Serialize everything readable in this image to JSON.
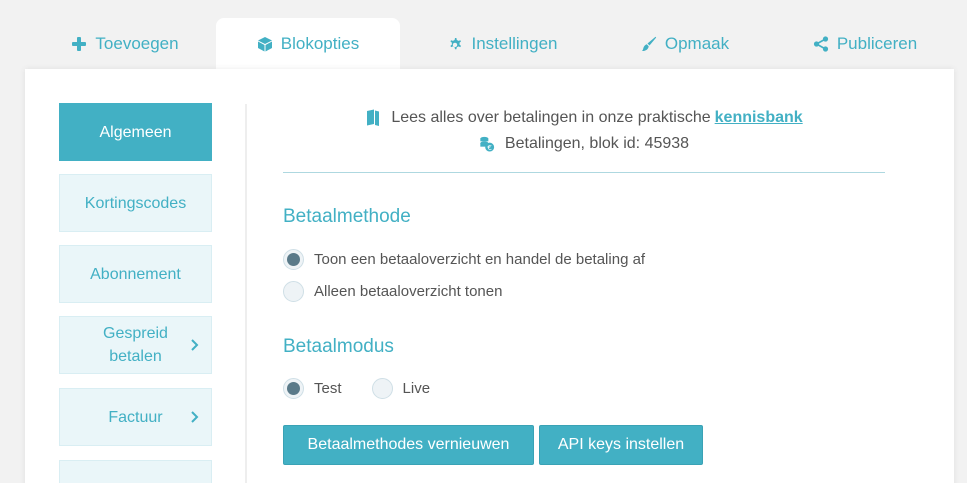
{
  "tabs": [
    {
      "label": "Toevoegen",
      "icon": "plus-icon"
    },
    {
      "label": "Blokopties",
      "icon": "cube-icon"
    },
    {
      "label": "Instellingen",
      "icon": "gear-icon"
    },
    {
      "label": "Opmaak",
      "icon": "brush-icon"
    },
    {
      "label": "Publiceren",
      "icon": "share-icon"
    }
  ],
  "sidebar": {
    "items": [
      {
        "label": "Algemeen"
      },
      {
        "label": "Kortingscodes"
      },
      {
        "label": "Abonnement"
      },
      {
        "label": "Gespreid betalen"
      },
      {
        "label": "Factuur"
      },
      {
        "label": ""
      }
    ]
  },
  "info": {
    "prefix": "Lees alles over betalingen in onze praktische",
    "link": "kennisbank",
    "block_label": "Betalingen, blok id: 45938"
  },
  "betaalmethode": {
    "heading": "Betaalmethode",
    "options": [
      {
        "label": "Toon een betaaloverzicht en handel de betaling af",
        "checked": true
      },
      {
        "label": "Alleen betaaloverzicht tonen",
        "checked": false
      }
    ]
  },
  "betaalmodus": {
    "heading": "Betaalmodus",
    "options": [
      {
        "label": "Test",
        "checked": true
      },
      {
        "label": "Live",
        "checked": false
      }
    ]
  },
  "buttons": {
    "refresh": "Betaalmethodes vernieuwen",
    "api_keys": "API keys instellen"
  },
  "colors": {
    "accent": "#42b0c4",
    "sidebar_bg": "#eaf6f9",
    "radio_checked": "#5a7a89"
  }
}
